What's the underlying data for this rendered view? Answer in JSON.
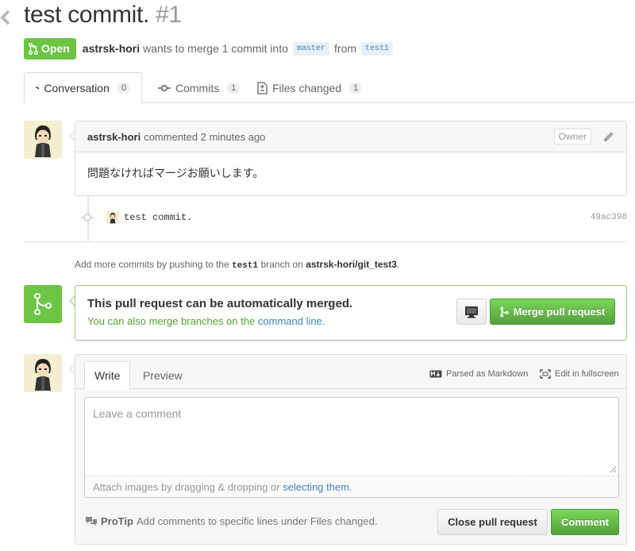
{
  "pr": {
    "title": "test commit.",
    "number": "#1",
    "state": "Open",
    "author": "astrsk-hori",
    "merge_text": "wants to merge 1 commit into",
    "base_branch": "master",
    "from_text": "from",
    "head_branch": "test1"
  },
  "tabs": [
    {
      "label": "Conversation",
      "count": "0",
      "icon": "conversation-icon"
    },
    {
      "label": "Commits",
      "count": "1",
      "icon": "commit-icon"
    },
    {
      "label": "Files changed",
      "count": "1",
      "icon": "file-diff-icon"
    }
  ],
  "comment": {
    "author": "astrsk-hori",
    "action": "commented",
    "time": "2 minutes ago",
    "badge": "Owner",
    "body": "問題なければマージお願いします。"
  },
  "commit": {
    "message": "test commit.",
    "sha": "49ac398"
  },
  "push_hint": {
    "prefix": "Add more commits by pushing to the",
    "branch": "test1",
    "middle": "branch on",
    "repo": "astrsk-hori/git_test3",
    "suffix": "."
  },
  "merge": {
    "title": "This pull request can be automatically merged.",
    "sub_prefix": "You can also merge branches on the",
    "sub_link": "command line.",
    "button_label": "Merge pull request"
  },
  "form": {
    "tab_write": "Write",
    "tab_preview": "Preview",
    "markdown_label": "Parsed as Markdown",
    "fullscreen_label": "Edit in fullscreen",
    "placeholder": "Leave a comment",
    "attach_prefix": "Attach images by dragging & dropping or",
    "attach_link": "selecting them",
    "attach_suffix": ".",
    "protip_label": "ProTip",
    "protip_text": "Add comments to specific lines under Files changed.",
    "close_label": "Close pull request",
    "comment_label": "Comment"
  },
  "colors": {
    "green": "#6cc644",
    "link": "#4183c4"
  }
}
